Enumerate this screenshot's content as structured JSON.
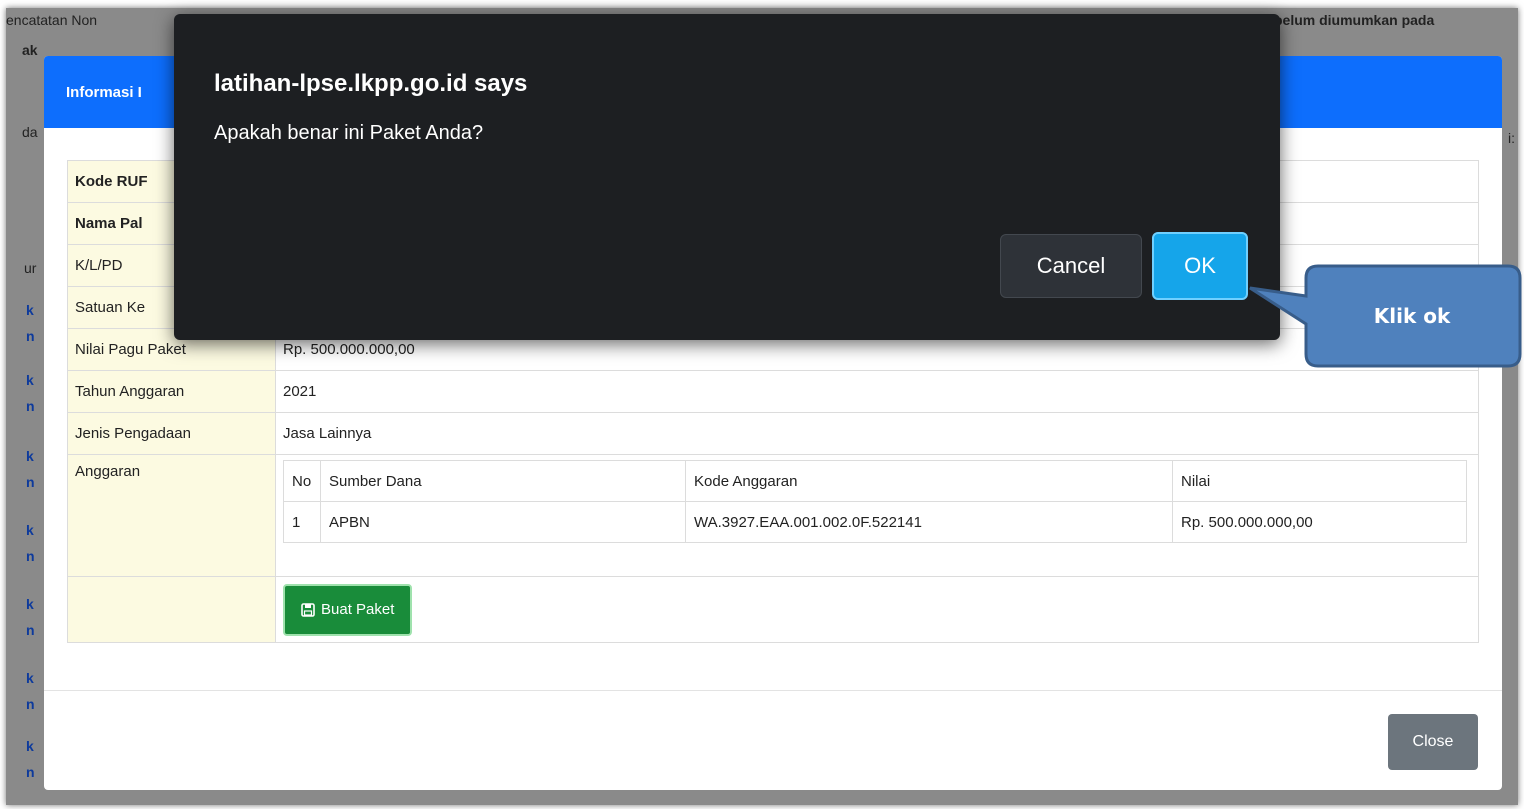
{
  "background": {
    "top_left_text": "encatatan Non",
    "top_right_text": "belum diumumkan pada",
    "second_line_left": "ak",
    "left_fragments": [
      "da",
      "ur"
    ],
    "right_fragment": "i:",
    "link_fragments": [
      "k",
      "n",
      "k",
      "n",
      "k",
      "n",
      "k",
      "n",
      "k",
      "n",
      "k",
      "n",
      "k",
      "n"
    ]
  },
  "modal": {
    "header_title": "Informasi I",
    "rows": {
      "kode_rup_label": "Kode RUF",
      "nama_paket_label": "Nama Pal",
      "klpd_label": "K/L/PD",
      "satuan_kerja_label": "Satuan Ke",
      "nilai_pagu_label": "Nilai Pagu Paket",
      "nilai_pagu_value": "Rp. 500.000.000,00",
      "tahun_label": "Tahun Anggaran",
      "tahun_value": "2021",
      "jenis_label": "Jenis Pengadaan",
      "jenis_value": "Jasa Lainnya",
      "anggaran_label": "Anggaran"
    },
    "anggaran_table": {
      "headers": [
        "No",
        "Sumber Dana",
        "Kode Anggaran",
        "Nilai"
      ],
      "rows": [
        [
          "1",
          "APBN",
          "WA.3927.EAA.001.002.0F.522141",
          "Rp. 500.000.000,00"
        ]
      ]
    },
    "buat_paket_label": "Buat Paket",
    "close_label": "Close"
  },
  "dialog": {
    "title": "latihan-lpse.lkpp.go.id says",
    "message": "Apakah benar ini Paket Anda?",
    "cancel_label": "Cancel",
    "ok_label": "OK"
  },
  "callout": {
    "text": "Klik ok",
    "fill_color": "#4f81bd",
    "border_color": "#385d8a"
  },
  "colors": {
    "modal_header": "#0d6efd",
    "buat_paket": "#198c3a",
    "close_button": "#6c757d",
    "dialog_bg": "#1d1f22",
    "ok_button": "#15a5ea"
  }
}
